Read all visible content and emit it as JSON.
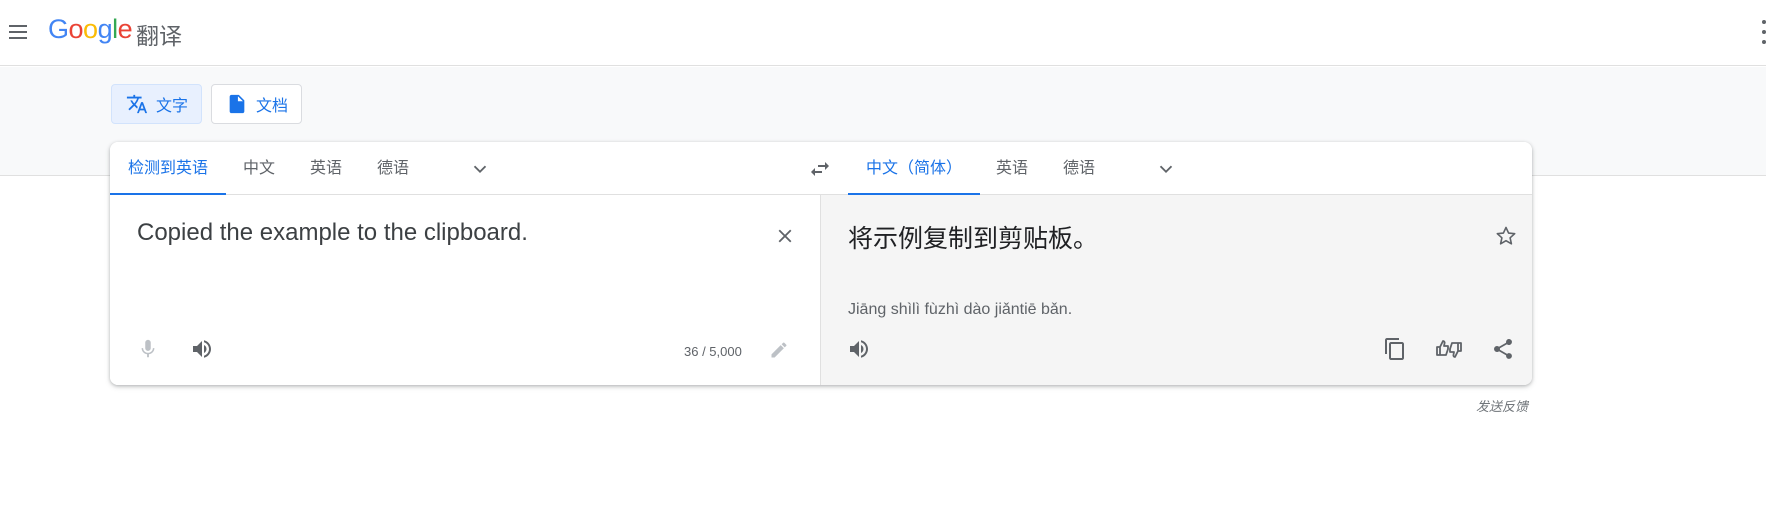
{
  "header": {
    "logo": {
      "g1": "G",
      "o1": "o",
      "o2": "o",
      "g2": "g",
      "l": "l",
      "e": "e"
    },
    "product_name": "翻译"
  },
  "modes": [
    {
      "label": "文字",
      "icon": "translate-icon",
      "active": true
    },
    {
      "label": "文档",
      "icon": "document-icon",
      "active": false
    }
  ],
  "source_langs": {
    "detected": "检测到英语",
    "items": [
      "中文",
      "英语",
      "德语"
    ]
  },
  "target_langs": {
    "active": "中文（简体）",
    "items": [
      "英语",
      "德语"
    ]
  },
  "source": {
    "text": "Copied the example to the clipboard.",
    "char_count": "36 / 5,000"
  },
  "target": {
    "text": "将示例复制到剪贴板。",
    "transliteration": "Jiāng shìlì fùzhì dào jiǎntiē bǎn."
  },
  "feedback_label": "发送反馈",
  "colors": {
    "accent": "#1a73e8",
    "icon": "#5f6368",
    "target_bg": "#f5f5f5"
  }
}
